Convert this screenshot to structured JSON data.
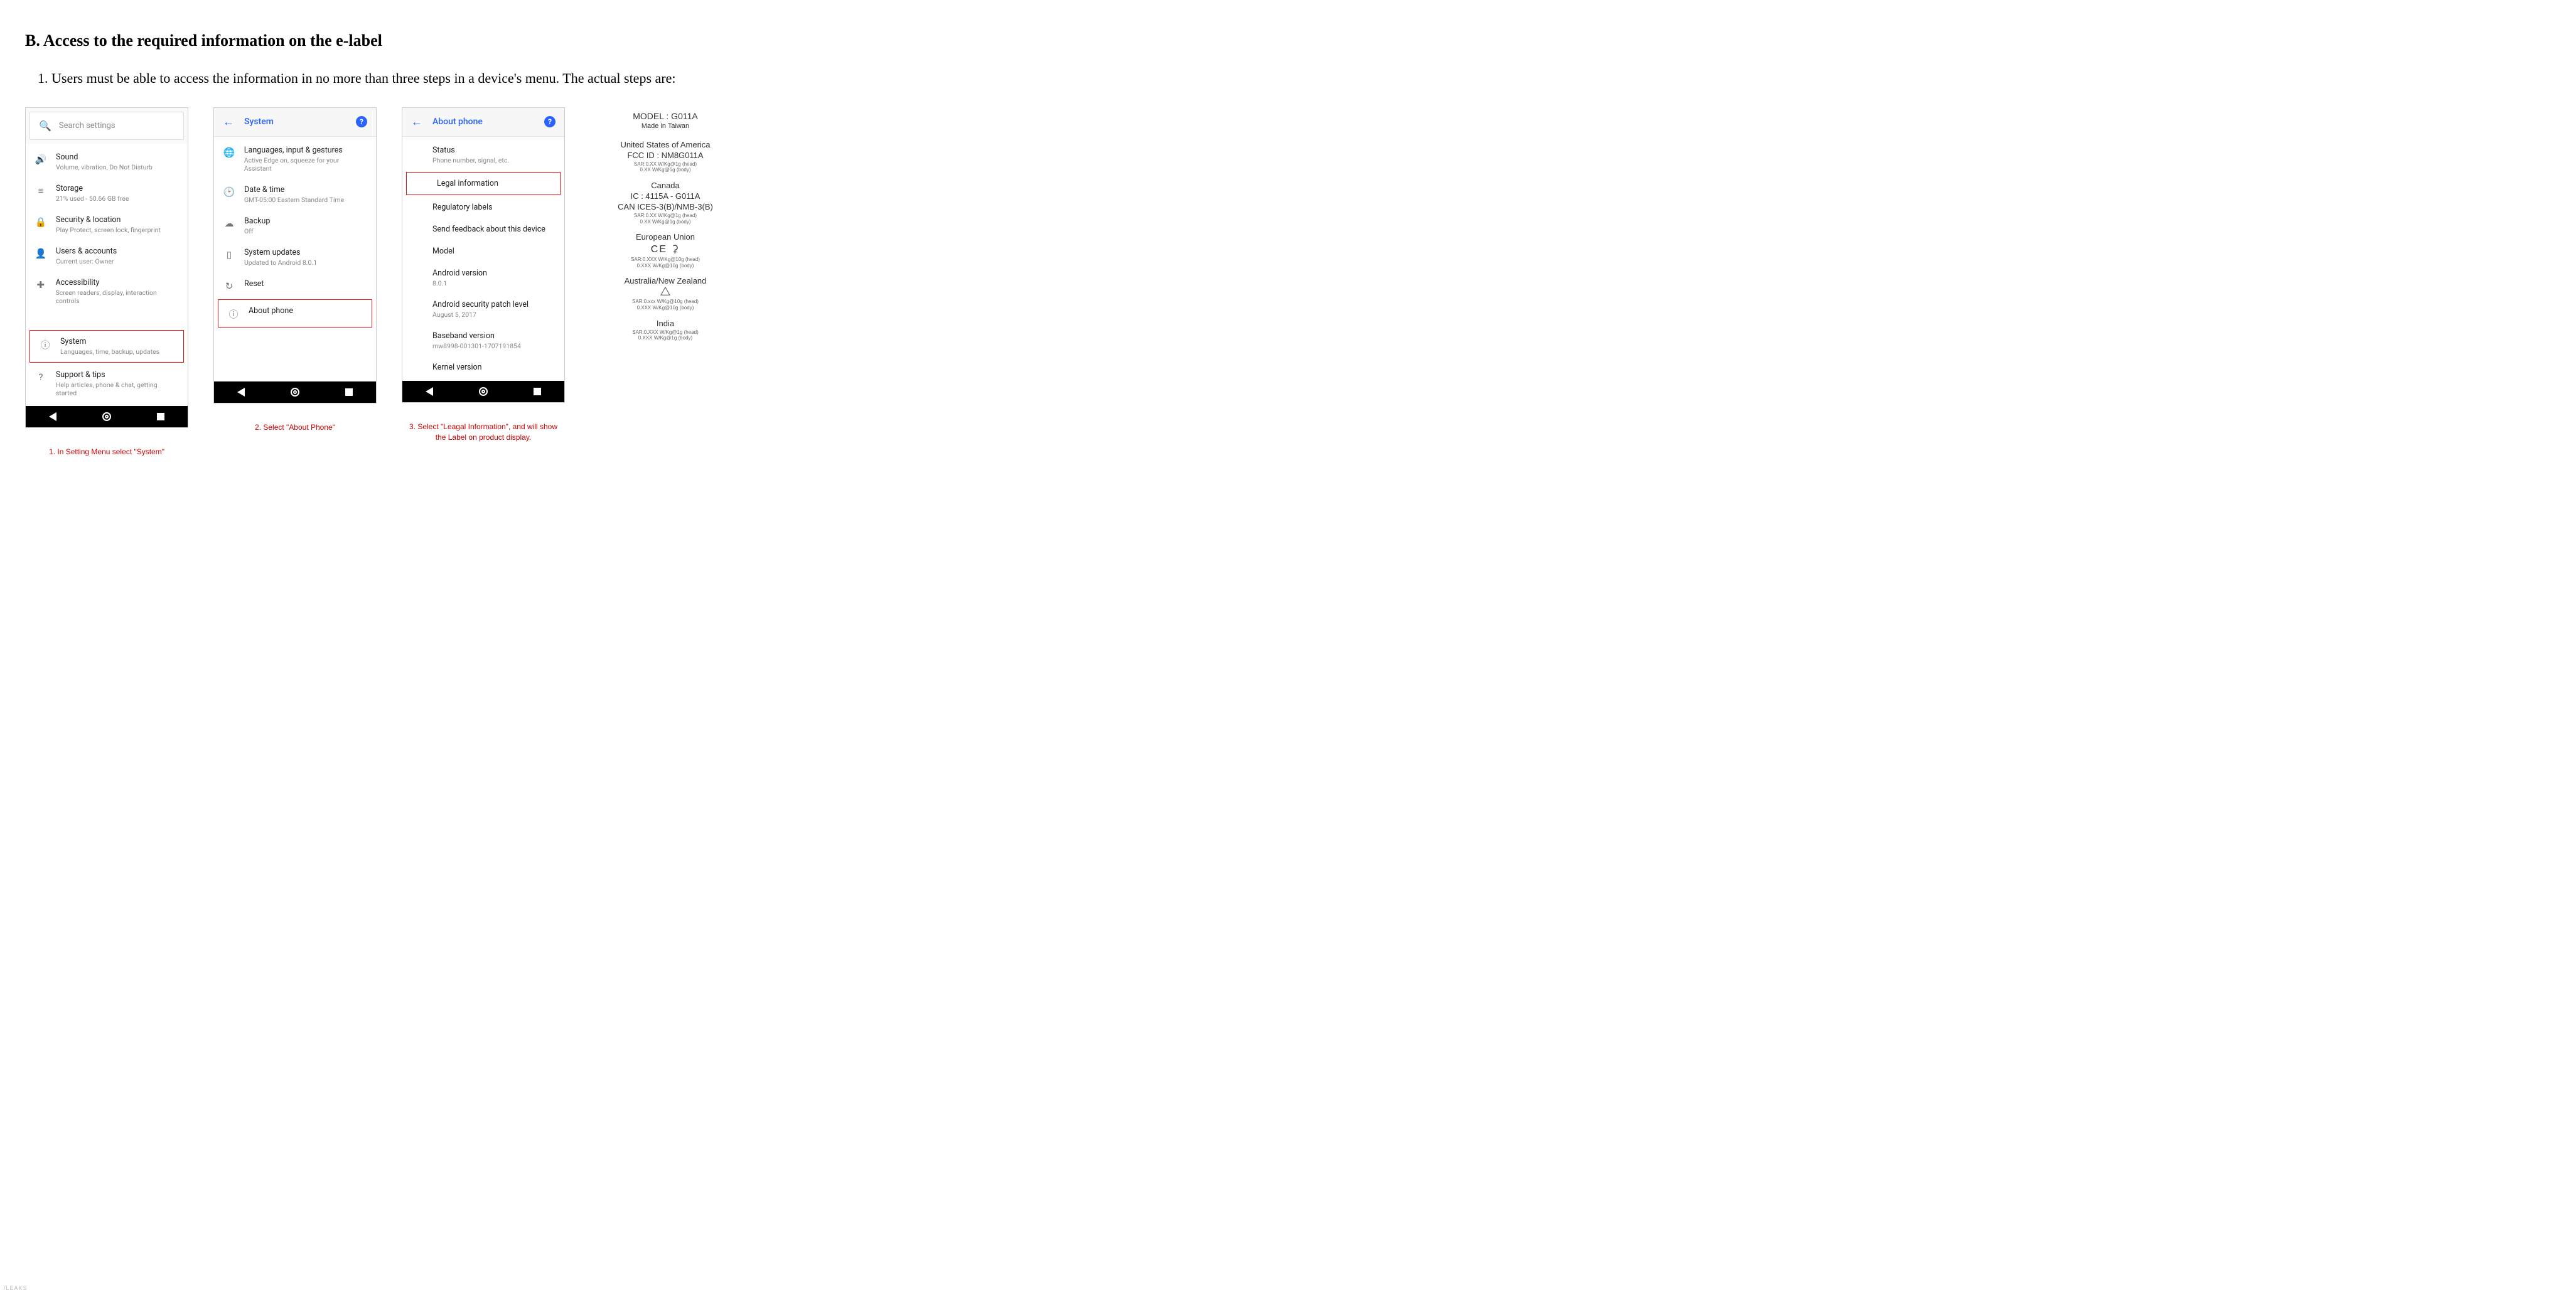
{
  "heading": "B. Access to the required information on the e-label",
  "instruction": "1. Users must be able to access the information in no more than three steps in a device's menu. The actual steps are:",
  "screen1": {
    "search_placeholder": "Search settings",
    "items": [
      {
        "icon": "🔊",
        "title": "Sound",
        "sub": "Volume, vibration, Do Not Disturb"
      },
      {
        "icon": "≡",
        "title": "Storage",
        "sub": "21% used - 50.66 GB free"
      },
      {
        "icon": "🔒",
        "title": "Security & location",
        "sub": "Play Protect, screen lock, fingerprint"
      },
      {
        "icon": "👤",
        "title": "Users & accounts",
        "sub": "Current user: Owner"
      },
      {
        "icon": "✚",
        "title": "Accessibility",
        "sub": "Screen readers, display, interaction controls"
      }
    ],
    "highlight": {
      "icon": "ⓘ",
      "title": "System",
      "sub": "Languages, time, backup, updates"
    },
    "after": {
      "icon": "?",
      "title": "Support & tips",
      "sub": "Help articles, phone & chat, getting started"
    },
    "caption": "1. In Setting Menu select \"System\""
  },
  "screen2": {
    "title": "System",
    "items": [
      {
        "icon": "🌐",
        "title": "Languages, input & gestures",
        "sub": "Active Edge on, squeeze for your Assistant"
      },
      {
        "icon": "🕑",
        "title": "Date & time",
        "sub": "GMT-05:00 Eastern Standard Time"
      },
      {
        "icon": "☁",
        "title": "Backup",
        "sub": "Off"
      },
      {
        "icon": "▯",
        "title": "System updates",
        "sub": "Updated to Android 8.0.1"
      },
      {
        "icon": "↻",
        "title": "Reset",
        "sub": ""
      }
    ],
    "highlight": {
      "icon": "ⓘ",
      "title": "About phone",
      "sub": ""
    },
    "caption": "2. Select \"About Phone\""
  },
  "screen3": {
    "title": "About phone",
    "items_before": [
      {
        "title": "Status",
        "sub": "Phone number, signal, etc."
      }
    ],
    "highlight": {
      "title": "Legal information",
      "sub": ""
    },
    "items_after": [
      {
        "title": "Regulatory labels",
        "sub": ""
      },
      {
        "title": "Send feedback about this device",
        "sub": ""
      },
      {
        "title": "Model",
        "sub": ""
      },
      {
        "title": "Android version",
        "sub": "8.0.1"
      },
      {
        "title": "Android security patch level",
        "sub": "August 5, 2017"
      },
      {
        "title": "Baseband version",
        "sub": "mw8998-001301-1707191854"
      },
      {
        "title": "Kernel version",
        "sub": ""
      }
    ],
    "caption": "3. Select \"Leagal Information\", and will show the Label on product display."
  },
  "elabel": {
    "model": "MODEL : G011A",
    "made": "Made in Taiwan",
    "regions": [
      {
        "name": "United States of America",
        "line": "FCC ID : NM8G011A",
        "sar1": "SAR:0.XX W/Kg@1g (head)",
        "sar2": "0.XX W/Kg@1g (body)"
      },
      {
        "name": "Canada",
        "line": "IC : 4115A - G011A",
        "line2": "CAN ICES-3(B)/NMB-3(B)",
        "sar1": "SAR:0.XX W/Kg@1g (head)",
        "sar2": "0.XX W/Kg@1g (body)"
      },
      {
        "name": "European Union",
        "symbol": "CE ⚳",
        "sar1": "SAR:0.XXX W/Kg@10g (head)",
        "sar2": "0.XXX W/Kg@10g (body)"
      },
      {
        "name": "Australia/New Zealand",
        "symbol": "△",
        "sar1": "SAR:0.xxx W/Kg@10g (head)",
        "sar2": "0.XXX W/Kg@10g (body)"
      },
      {
        "name": "India",
        "sar1": "SAR:0.XXX W/Kg@1g (head)",
        "sar2": "0.XXX W/Kg@1g (body)"
      }
    ]
  },
  "watermark": "/LEAKS"
}
